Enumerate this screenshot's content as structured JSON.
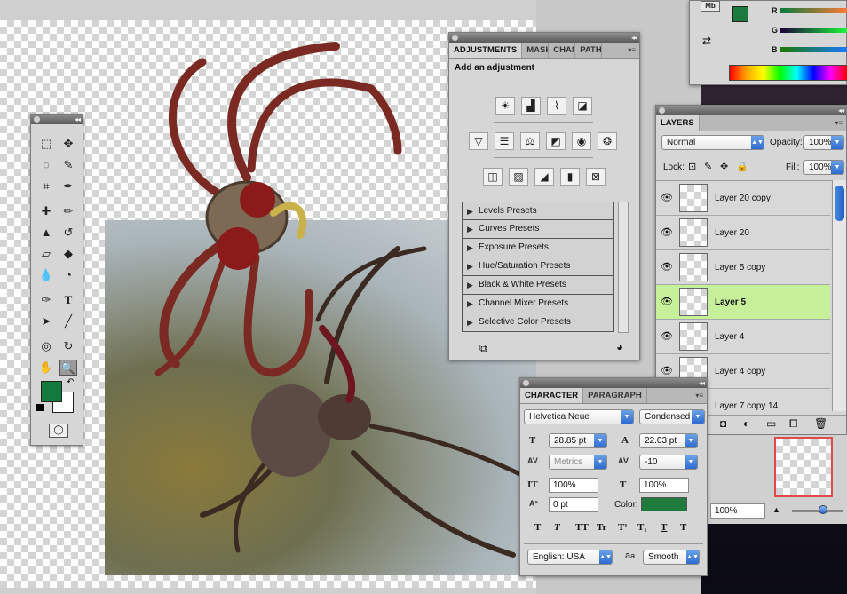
{
  "adjustments": {
    "tabs": [
      "ADJUSTMENTS",
      "MASK",
      "CHAN",
      "PATH"
    ],
    "heading": "Add an adjustment",
    "icons_row1": [
      "brightness-contrast-icon",
      "levels-icon",
      "curves-icon",
      "exposure-icon"
    ],
    "icons_row2": [
      "vibrance-icon",
      "hue-saturation-icon",
      "color-balance-icon",
      "black-white-icon",
      "photo-filter-icon",
      "channel-mixer-icon"
    ],
    "icons_row3": [
      "invert-icon",
      "posterize-icon",
      "threshold-icon",
      "gradient-map-icon",
      "selective-color-icon"
    ],
    "presets": [
      "Levels Presets",
      "Curves Presets",
      "Exposure Presets",
      "Hue/Saturation Presets",
      "Black & White Presets",
      "Channel Mixer Presets",
      "Selective Color Presets"
    ]
  },
  "layers": {
    "tab": "LAYERS",
    "blend_mode": "Normal",
    "opacity_label": "Opacity:",
    "opacity_value": "100%",
    "lock_label": "Lock:",
    "fill_label": "Fill:",
    "fill_value": "100%",
    "items": [
      "Layer 20 copy",
      "Layer 20",
      "Layer 5 copy",
      "Layer 5",
      "Layer 4",
      "Layer 4 copy",
      "Layer 7 copy 14"
    ],
    "selected_index": 3
  },
  "character": {
    "tabs": [
      "CHARACTER",
      "PARAGRAPH"
    ],
    "font_family": "Helvetica Neue",
    "font_style": "Condensed",
    "font_size": "28.85 pt",
    "leading": "22.03 pt",
    "kerning": "Metrics",
    "tracking": "-10",
    "vertical_scale": "100%",
    "horizontal_scale": "100%",
    "baseline_shift": "0 pt",
    "color_label": "Color:",
    "text_color": "#1f7a3e",
    "language": "English: USA",
    "aa_glyph": "a",
    "aa_glyph_2": "a",
    "antialias": "Smooth",
    "style_buttons": [
      "T",
      "T",
      "TT",
      "Tr",
      "T¹",
      "T₁",
      "T",
      "T"
    ]
  },
  "color_panel": {
    "r_label": "R",
    "g_label": "G",
    "b_label": "B",
    "mb_label": "Mb",
    "foreground": "#1d7a3f"
  },
  "navigator": {
    "zoom": "100%"
  },
  "toolbox": {
    "foreground": "#117a3c",
    "background": "#ffffff"
  }
}
